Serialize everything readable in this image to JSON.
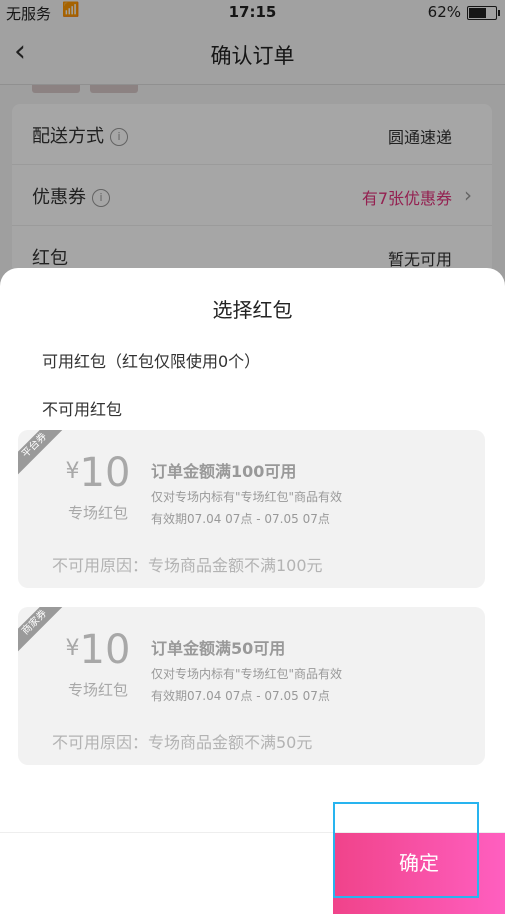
{
  "status_bar": {
    "carrier": "无服务",
    "time": "17:15",
    "battery": "62%"
  },
  "nav": {
    "title": "确认订单"
  },
  "order": {
    "rows": [
      {
        "label": "配送方式",
        "value": "圆通速递"
      },
      {
        "label": "优惠券",
        "value": "有7张优惠券"
      },
      {
        "label": "红包",
        "value": "暂无可用"
      }
    ]
  },
  "sheet": {
    "title": "选择红包",
    "available_label": "可用红包（红包仅限使用0个）",
    "unavailable_label": "不可用红包",
    "coupons": [
      {
        "tag": "平台券",
        "currency": "¥",
        "amount": "10",
        "type": "专场红包",
        "condition": "订单金额满100可用",
        "scope": "仅对专场内标有\"专场红包\"商品有效",
        "validity": "有效期07.04 07点 - 07.05 07点",
        "reason": "不可用原因：专场商品金额不满100元"
      },
      {
        "tag": "商家券",
        "currency": "¥",
        "amount": "10",
        "type": "专场红包",
        "condition": "订单金额满50可用",
        "scope": "仅对专场内标有\"专场红包\"商品有效",
        "validity": "有效期07.04 07点 - 07.05 07点",
        "reason": "不可用原因：专场商品金额不满50元"
      }
    ],
    "confirm_label": "确定"
  },
  "colors": {
    "accent": "#e4337d",
    "confirm_gradient_start": "#f0438a",
    "highlight": "#28b4ef"
  }
}
